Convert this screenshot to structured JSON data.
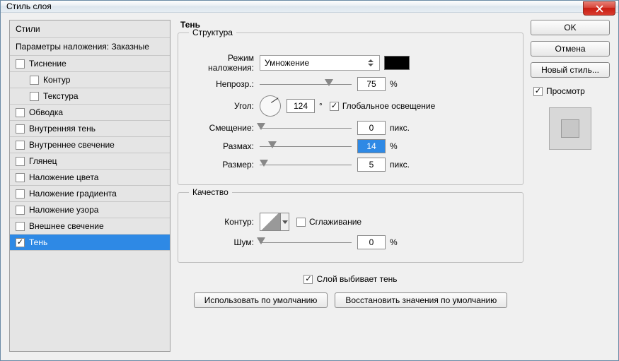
{
  "window": {
    "title": "Стиль слоя"
  },
  "sidebar": {
    "header": "Стили",
    "subheader": "Параметры наложения: Заказные",
    "items": [
      {
        "label": "Тиснение",
        "checked": false,
        "indent": false
      },
      {
        "label": "Контур",
        "checked": false,
        "indent": true
      },
      {
        "label": "Текстура",
        "checked": false,
        "indent": true
      },
      {
        "label": "Обводка",
        "checked": false,
        "indent": false
      },
      {
        "label": "Внутренняя тень",
        "checked": false,
        "indent": false
      },
      {
        "label": "Внутреннее свечение",
        "checked": false,
        "indent": false
      },
      {
        "label": "Глянец",
        "checked": false,
        "indent": false
      },
      {
        "label": "Наложение цвета",
        "checked": false,
        "indent": false
      },
      {
        "label": "Наложение градиента",
        "checked": false,
        "indent": false
      },
      {
        "label": "Наложение узора",
        "checked": false,
        "indent": false
      },
      {
        "label": "Внешнее свечение",
        "checked": false,
        "indent": false
      },
      {
        "label": "Тень",
        "checked": true,
        "indent": false,
        "selected": true
      }
    ]
  },
  "main": {
    "title": "Тень",
    "structure": {
      "title": "Структура",
      "blend_label": "Режим наложения:",
      "blend_value": "Умножение",
      "color": "#000000",
      "opacity_label": "Непрозр.:",
      "opacity_value": "75",
      "opacity_unit": "%",
      "angle_label": "Угол:",
      "angle_value": "124",
      "angle_unit": "°",
      "global_light_label": "Глобальное освещение",
      "global_light_checked": true,
      "distance_label": "Смещение:",
      "distance_value": "0",
      "distance_unit": "пикс.",
      "spread_label": "Размах:",
      "spread_value": "14",
      "spread_unit": "%",
      "size_label": "Размер:",
      "size_value": "5",
      "size_unit": "пикс."
    },
    "quality": {
      "title": "Качество",
      "contour_label": "Контур:",
      "antialias_label": "Сглаживание",
      "antialias_checked": false,
      "noise_label": "Шум:",
      "noise_value": "0",
      "noise_unit": "%"
    },
    "knockout_label": "Слой выбивает тень",
    "knockout_checked": true,
    "btn_default": "Использовать по умолчанию",
    "btn_reset": "Восстановить значения по умолчанию"
  },
  "right": {
    "ok": "OK",
    "cancel": "Отмена",
    "new_style": "Новый стиль...",
    "preview_label": "Просмотр",
    "preview_checked": true
  }
}
